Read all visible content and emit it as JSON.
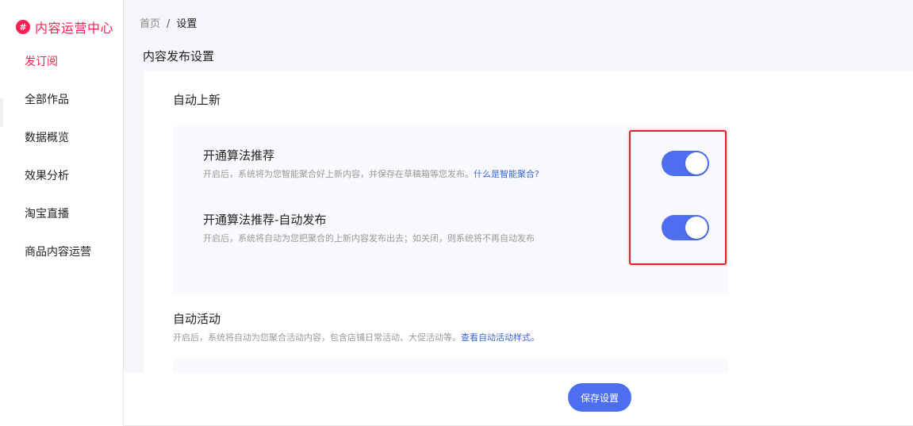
{
  "app": {
    "logo_glyph": "#",
    "title": "内容运营中心",
    "brand_color": "#ff1f55",
    "accent_color": "#4e6ef2"
  },
  "sidebar": {
    "items": [
      {
        "label": "发订阅",
        "active": true
      },
      {
        "label": "全部作品",
        "active": false
      },
      {
        "label": "数据概览",
        "active": false
      },
      {
        "label": "效果分析",
        "active": false
      },
      {
        "label": "淘宝直播",
        "active": false
      },
      {
        "label": "商品内容运营",
        "active": false
      }
    ]
  },
  "breadcrumb": {
    "home": "首页",
    "separator": "/",
    "current": "设置"
  },
  "page": {
    "title": "内容发布设置"
  },
  "auto_new": {
    "title": "自动上新",
    "options": [
      {
        "title": "开通算法推荐",
        "desc": "开启后，系统将为您智能聚合好上新内容，并保存在草稿箱等您发布。",
        "link": "什么是智能聚合?",
        "enabled": true
      },
      {
        "title": "开通算法推荐-自动发布",
        "desc": "开启后，系统将自动为您把聚合的上新内容发布出去；如关闭，则系统将不再自动发布",
        "enabled": true
      }
    ]
  },
  "auto_activity": {
    "title": "自动活动",
    "desc": "开启后，系统将自动为您聚合活动内容，包含店铺日常活动、大促活动等。",
    "link": "查看自动活动样式。"
  },
  "footer": {
    "save_label": "保存设置"
  }
}
